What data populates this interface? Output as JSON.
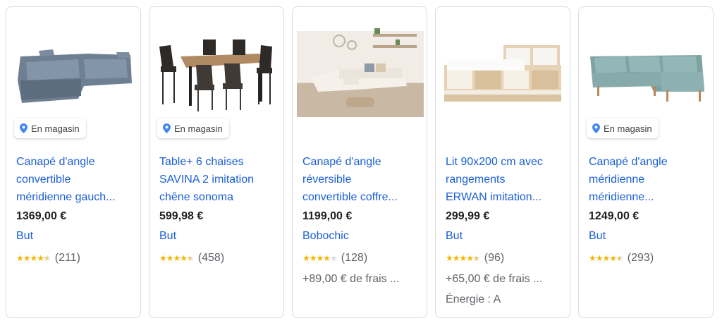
{
  "badge_label": "En magasin",
  "products": [
    {
      "title_lines": [
        "Canapé d'angle",
        "convertible",
        "méridienne gauch..."
      ],
      "price": "1369,00 €",
      "seller": "But",
      "rating": 4.5,
      "stars": "★★★★★",
      "reviews": "(211)",
      "extra": "",
      "extra2": "",
      "image": "grey-corner-sofa",
      "in_store": true
    },
    {
      "title_lines": [
        "Table+ 6 chaises",
        "SAVINA 2 imitation",
        "chêne sonoma"
      ],
      "price": "599,98 €",
      "seller": "But",
      "rating": 4.5,
      "stars": "★★★★★",
      "reviews": "(458)",
      "extra": "",
      "extra2": "",
      "image": "dining-table-chairs",
      "in_store": true
    },
    {
      "title_lines": [
        "Canapé d'angle",
        "réversible",
        "convertible coffre..."
      ],
      "price": "1199,00 €",
      "seller": "Bobochic",
      "rating": 4.0,
      "stars": "★★★★★",
      "reviews": "(128)",
      "extra": "+89,00 € de frais ...",
      "extra2": "",
      "image": "living-room-sofa",
      "in_store": false
    },
    {
      "title_lines": [
        "Lit 90x200 cm avec",
        "rangements",
        "ERWAN imitation..."
      ],
      "price": "299,99 €",
      "seller": "But",
      "rating": 4.5,
      "stars": "★★★★★",
      "reviews": "(96)",
      "extra": "+65,00 € de frais ...",
      "extra2": "Énergie : A",
      "image": "storage-bed",
      "in_store": false
    },
    {
      "title_lines": [
        "Canapé d'angle",
        "méridienne",
        "méridienne..."
      ],
      "price": "1249,00 €",
      "seller": "But",
      "rating": 4.5,
      "stars": "★★★★★",
      "reviews": "(293)",
      "extra": "",
      "extra2": "",
      "image": "teal-corner-sofa",
      "in_store": true
    }
  ],
  "colors": {
    "link": "#1a5fd6",
    "star": "#f4b400",
    "border": "#dadce0",
    "pin": "#4285f4"
  }
}
